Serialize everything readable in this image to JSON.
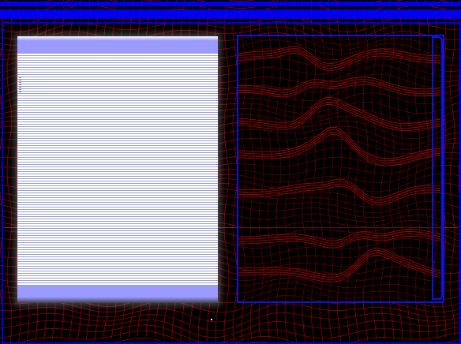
{
  "window": {
    "title": ""
  },
  "colors": {
    "background": "#000000",
    "wireframe": "#cc0000",
    "accent": "#0000ee",
    "panel_light": "#9a9aff",
    "panel_white": "#ffffff"
  },
  "left_panel": {
    "content": ""
  },
  "right_panel": {
    "content": ""
  },
  "icons": [
    "scrollbar-track"
  ]
}
